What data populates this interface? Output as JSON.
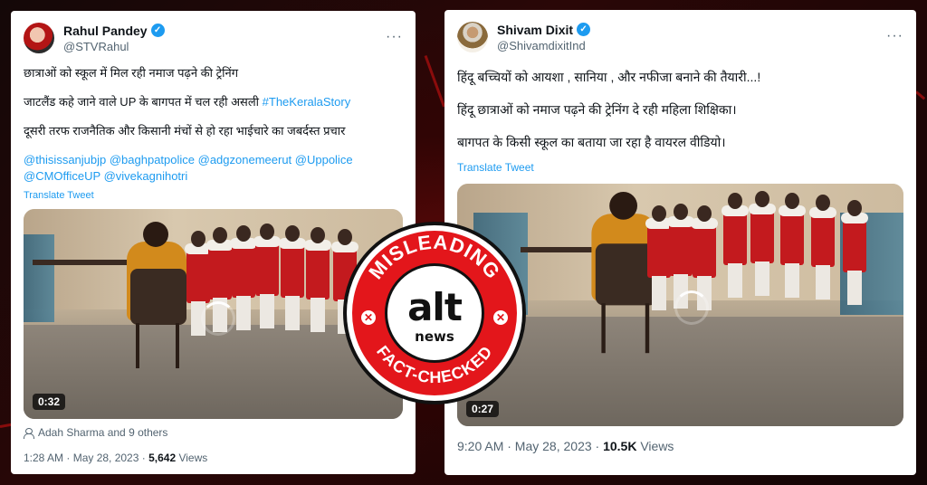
{
  "tweet_left": {
    "name": "Rahul Pandey",
    "handle": "@STVRahul",
    "lines": [
      "छात्राओं को स्कूल में मिल रही नमाज पढ़ने की ट्रेनिंग",
      "जाटलैंड कहे जाने वाले UP के बागपत में चल रही असली",
      "दूसरी तरफ राजनैतिक और किसानी मंचों से हो रहा भाईचारे का जबर्दस्त प्रचार"
    ],
    "hashtag": "#TheKeralaStory",
    "mentions_line1": "@thisissanjubjp @baghpatpolice @adgzonemeerut @Uppolice",
    "mentions_line2": "@CMOfficeUP @vivekagnihotri",
    "translate": "Translate Tweet",
    "duration": "0:32",
    "liked_by": "Adah Sharma and 9 others",
    "time": "1:28 AM · May 28, 2023 ·",
    "views_count": "5,642",
    "views_label": "Views"
  },
  "tweet_right": {
    "name": "Shivam Dixit",
    "handle": "@ShivamdixitInd",
    "lines": [
      "हिंदू बच्चियों को आयशा , सानिया , और नफीजा बनाने की तैयारी...!",
      "हिंदू छात्राओं को नमाज पढ़ने की ट्रेनिंग दे रही महिला शिक्षिका।",
      "बागपत के किसी स्कूल का बताया जा रहा है वायरल वीडियो।"
    ],
    "translate": "Translate Tweet",
    "duration": "0:27",
    "time": "9:20 AM · May 28, 2023 ·",
    "views_count": "10.5K",
    "views_label": "Views"
  },
  "stamp": {
    "top_text": "MISLEADING",
    "logo": "alt",
    "logo_sub": "news",
    "bottom_text": "FACT-CHECKED"
  },
  "icons": {
    "more": "more-icon",
    "verified": "verified-badge-icon",
    "person": "person-icon"
  },
  "colors": {
    "brand_red": "#e3161b",
    "link_blue": "#1d9bf0",
    "uniform_red": "#c31a1e"
  }
}
